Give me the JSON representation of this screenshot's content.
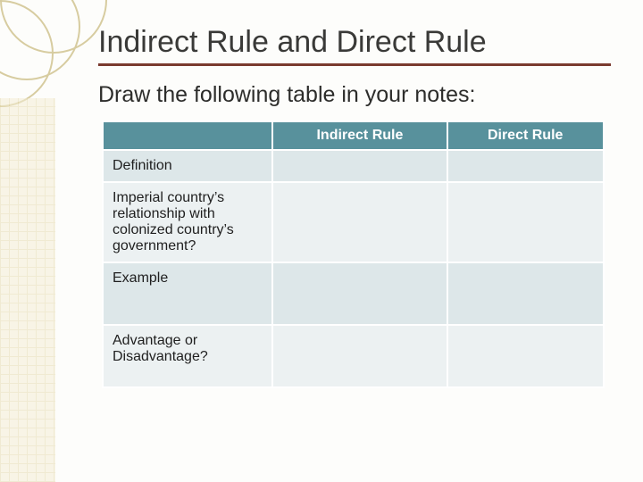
{
  "title": "Indirect Rule and Direct Rule",
  "subtitle": "Draw the following table in your notes:",
  "table": {
    "header_blank": "",
    "header_col1": "Indirect Rule",
    "header_col2": "Direct Rule",
    "rows": [
      {
        "label": "Definition",
        "c1": "",
        "c2": ""
      },
      {
        "label": "Imperial country’s relationship with colonized country’s government?",
        "c1": "",
        "c2": ""
      },
      {
        "label": "Example",
        "c1": "",
        "c2": ""
      },
      {
        "label": "Advantage or Disadvantage?",
        "c1": "",
        "c2": ""
      }
    ]
  }
}
